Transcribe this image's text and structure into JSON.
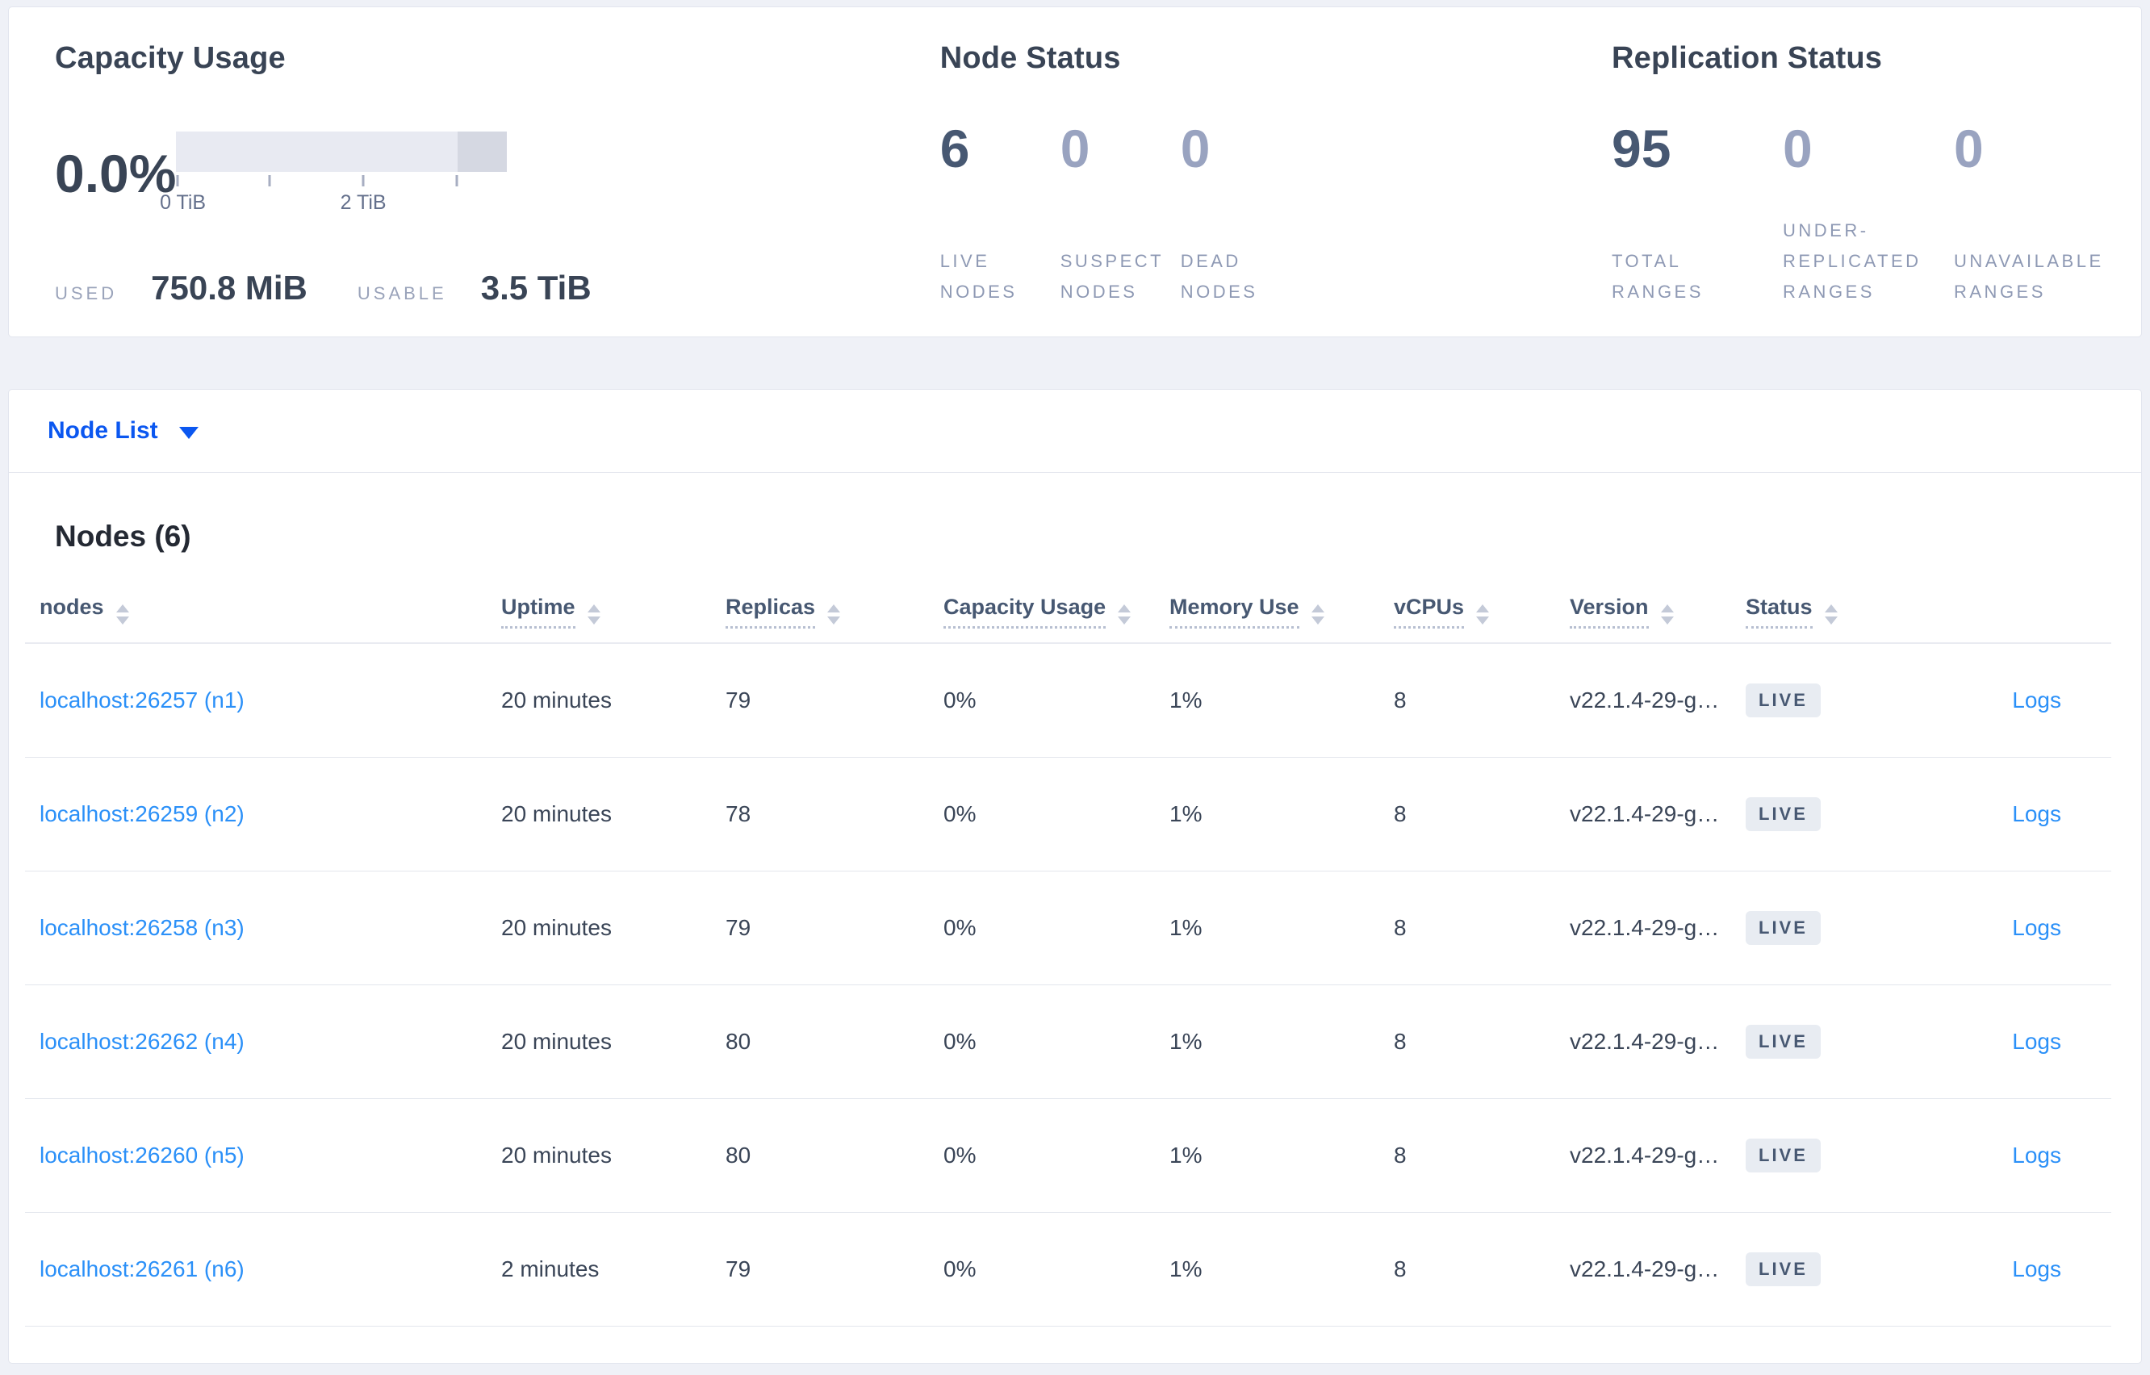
{
  "colors": {
    "accent_blue": "#0b57f0",
    "link_blue": "#2b90f8",
    "text_dark": "#394455",
    "text_slate": "#475872",
    "text_muted": "#8e99b4",
    "badge_bg": "#e8ecf2",
    "bar_light": "#e8eaf2",
    "bar_dark": "#d5d8e2"
  },
  "summary": {
    "capacity": {
      "title": "Capacity Usage",
      "percent": "0.0%",
      "used_label": "USED",
      "used_value": "750.8 MiB",
      "usable_label": "USABLE",
      "usable_value": "3.5 TiB",
      "axis_labels": [
        "0 TiB",
        "2 TiB"
      ],
      "bar": {
        "used_fraction": 0.0,
        "usable_tib": 3.5,
        "dark_segment_fraction": 0.15
      }
    },
    "node_status": {
      "title": "Node Status",
      "stats": [
        {
          "value": "6",
          "label": "LIVE NODES"
        },
        {
          "value": "0",
          "label": "SUSPECT NODES"
        },
        {
          "value": "0",
          "label": "DEAD NODES"
        }
      ]
    },
    "replication_status": {
      "title": "Replication Status",
      "stats": [
        {
          "value": "95",
          "label": "TOTAL RANGES"
        },
        {
          "value": "0",
          "label": "UNDER-REPLICATED RANGES"
        },
        {
          "value": "0",
          "label": "UNAVAILABLE RANGES"
        }
      ]
    }
  },
  "node_list": {
    "label": "Node List"
  },
  "nodes_section": {
    "heading": "Nodes (6)",
    "table": {
      "columns": [
        {
          "label": "nodes"
        },
        {
          "label": "Uptime"
        },
        {
          "label": "Replicas"
        },
        {
          "label": "Capacity Usage"
        },
        {
          "label": "Memory Use"
        },
        {
          "label": "vCPUs"
        },
        {
          "label": "Version"
        },
        {
          "label": "Status"
        }
      ],
      "rows": [
        {
          "name": "localhost:26257 (n1)",
          "uptime": "20 minutes",
          "replicas": "79",
          "capacity": "0%",
          "memory": "1%",
          "vcpus": "8",
          "version": "v22.1.4-29-g…",
          "status": "LIVE",
          "logs": "Logs"
        },
        {
          "name": "localhost:26259 (n2)",
          "uptime": "20 minutes",
          "replicas": "78",
          "capacity": "0%",
          "memory": "1%",
          "vcpus": "8",
          "version": "v22.1.4-29-g…",
          "status": "LIVE",
          "logs": "Logs"
        },
        {
          "name": "localhost:26258 (n3)",
          "uptime": "20 minutes",
          "replicas": "79",
          "capacity": "0%",
          "memory": "1%",
          "vcpus": "8",
          "version": "v22.1.4-29-g…",
          "status": "LIVE",
          "logs": "Logs"
        },
        {
          "name": "localhost:26262 (n4)",
          "uptime": "20 minutes",
          "replicas": "80",
          "capacity": "0%",
          "memory": "1%",
          "vcpus": "8",
          "version": "v22.1.4-29-g…",
          "status": "LIVE",
          "logs": "Logs"
        },
        {
          "name": "localhost:26260 (n5)",
          "uptime": "20 minutes",
          "replicas": "80",
          "capacity": "0%",
          "memory": "1%",
          "vcpus": "8",
          "version": "v22.1.4-29-g…",
          "status": "LIVE",
          "logs": "Logs"
        },
        {
          "name": "localhost:26261 (n6)",
          "uptime": "2 minutes",
          "replicas": "79",
          "capacity": "0%",
          "memory": "1%",
          "vcpus": "8",
          "version": "v22.1.4-29-g…",
          "status": "LIVE",
          "logs": "Logs"
        }
      ]
    }
  }
}
